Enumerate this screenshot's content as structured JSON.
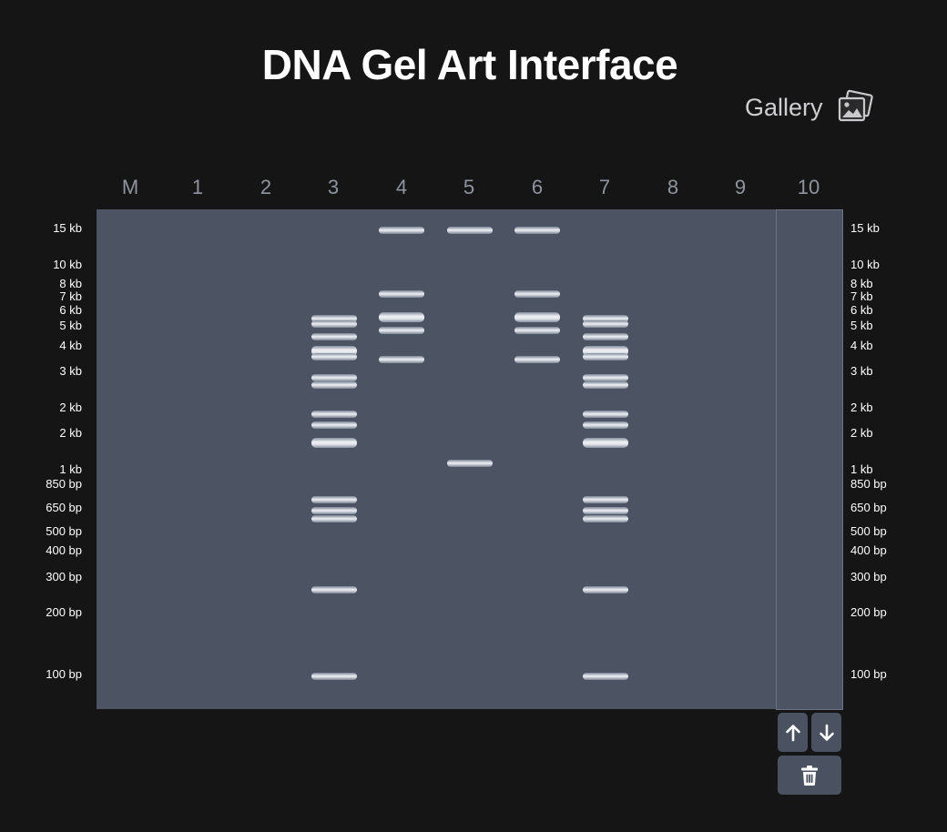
{
  "title": "DNA Gel Art Interface",
  "gallery": {
    "label": "Gallery",
    "icon": "photo-gallery-icon"
  },
  "lanes": [
    "M",
    "1",
    "2",
    "3",
    "4",
    "5",
    "6",
    "7",
    "8",
    "9",
    "10"
  ],
  "size_markers": [
    "15 kb",
    "10 kb",
    "8 kb",
    "7 kb",
    "6 kb",
    "5 kb",
    "4 kb",
    "3 kb",
    "2 kb",
    "2 kb",
    "1 kb",
    "850 bp",
    "650 bp",
    "500 bp",
    "400 bp",
    "300 bp",
    "200 bp",
    "100 bp"
  ],
  "bands": {
    "lane_3": [
      "5 kb",
      "5 kb",
      "4 kb",
      "4 kb",
      "3 kb",
      "3 kb",
      "2 kb",
      "2 kb",
      "2 kb",
      "650 bp",
      "650 bp",
      "500 bp",
      "300 bp",
      "100 bp"
    ],
    "lane_4": [
      "15 kb",
      "7 kb",
      "5 kb",
      "5 kb",
      "3 kb"
    ],
    "lane_5": [
      "15 kb",
      "1 kb"
    ],
    "lane_6": [
      "15 kb",
      "7 kb",
      "5 kb",
      "5 kb",
      "3 kb"
    ],
    "lane_7": [
      "5 kb",
      "5 kb",
      "4 kb",
      "4 kb",
      "3 kb",
      "3 kb",
      "2 kb",
      "2 kb",
      "2 kb",
      "650 bp",
      "650 bp",
      "500 bp",
      "300 bp",
      "100 bp"
    ]
  },
  "selected_lane": "10",
  "controls": {
    "move_up_icon": "arrow-up-icon",
    "move_down_icon": "arrow-down-icon",
    "delete_icon": "trash-icon"
  },
  "colors": {
    "background": "#151515",
    "gel": "#4c5362",
    "band": "#eef0f4",
    "button": "#4a5160"
  }
}
